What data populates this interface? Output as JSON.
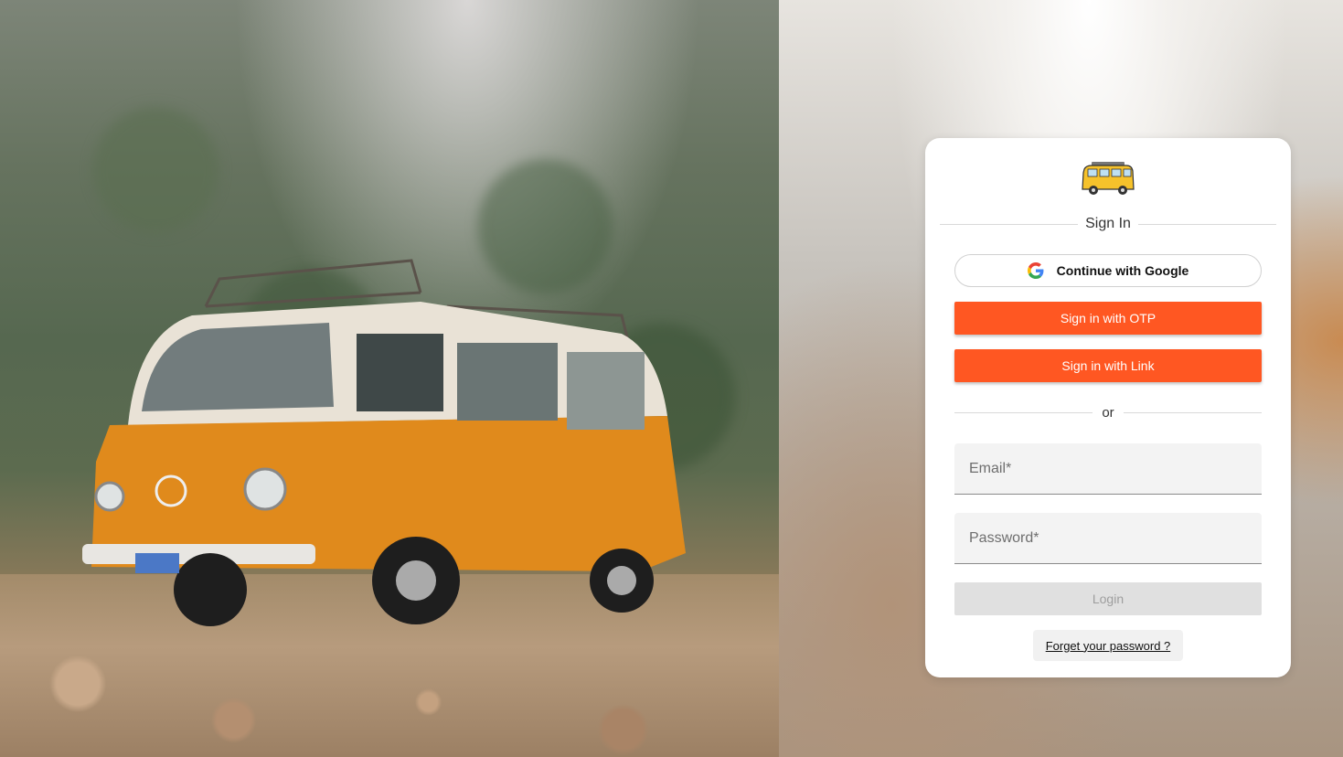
{
  "card": {
    "title": "Sign In",
    "google_button": {
      "label": "Continue with Google",
      "icon": "google-icon"
    },
    "otp_button": {
      "label": "Sign in with OTP",
      "color": "#ff5722"
    },
    "link_button": {
      "label": "Sign in with Link",
      "color": "#ff5722"
    },
    "divider_label": "or",
    "email_field": {
      "placeholder": "Email*",
      "value": ""
    },
    "password_field": {
      "placeholder": "Password*",
      "value": ""
    },
    "login_button": {
      "label": "Login",
      "state": "disabled"
    },
    "forgot_link": {
      "label": "Forget your password ?"
    }
  },
  "brand": {
    "logo_icon": "van-logo-icon",
    "accent": "#ff5722"
  },
  "hero": {
    "image_icon": "van-photo"
  }
}
